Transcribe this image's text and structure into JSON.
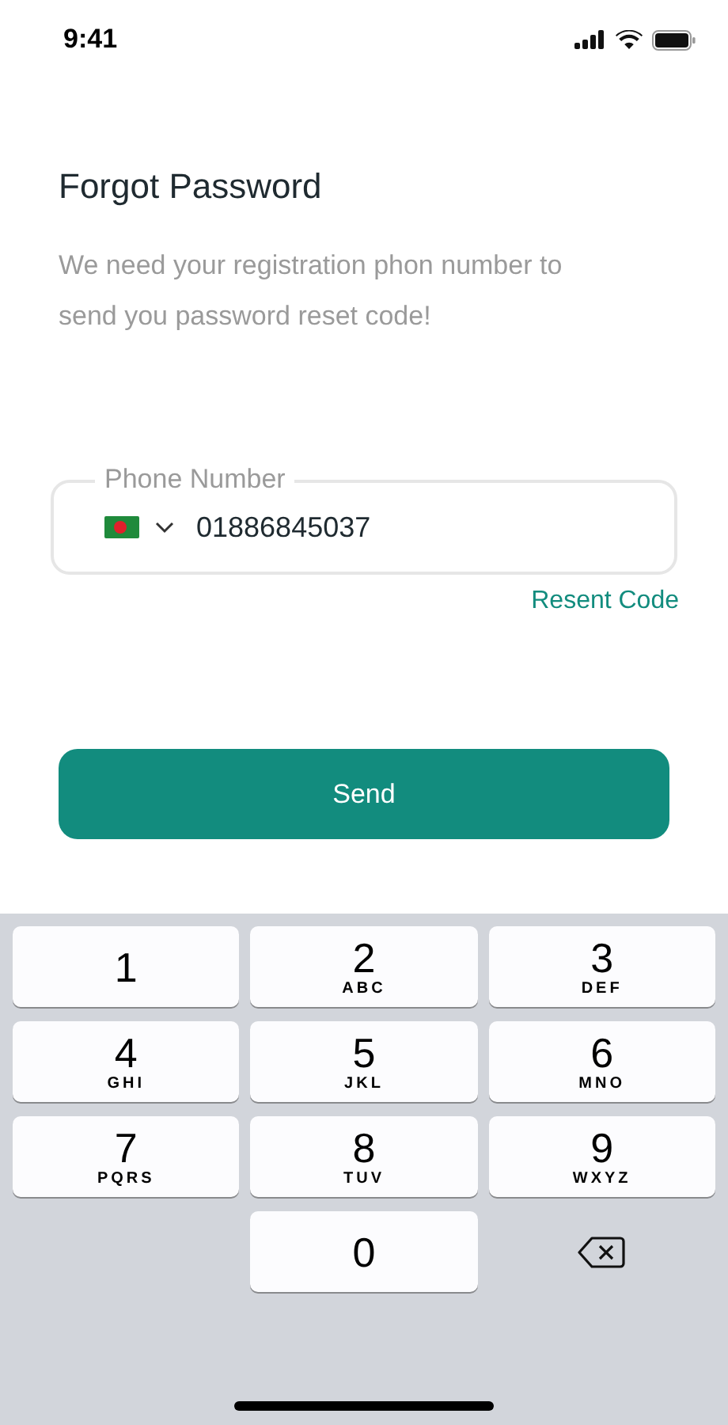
{
  "status_bar": {
    "time": "9:41"
  },
  "title": "Forgot Password",
  "description": "We need your registration phon number to send you password reset code!",
  "phone_field": {
    "label": "Phone Number",
    "value": "01886845037"
  },
  "resend_link": "Resent Code",
  "send_button": "Send",
  "keypad": [
    {
      "kind": "digit",
      "digit": "1"
    },
    {
      "kind": "digit",
      "digit": "2",
      "letters": "ABC"
    },
    {
      "kind": "digit",
      "digit": "3",
      "letters": "DEF"
    },
    {
      "kind": "digit",
      "digit": "4",
      "letters": "GHI"
    },
    {
      "kind": "digit",
      "digit": "5",
      "letters": "JKL"
    },
    {
      "kind": "digit",
      "digit": "6",
      "letters": "MNO"
    },
    {
      "kind": "digit",
      "digit": "7",
      "letters": "PQRS"
    },
    {
      "kind": "digit",
      "digit": "8",
      "letters": "TUV"
    },
    {
      "kind": "digit",
      "digit": "9",
      "letters": "WXYZ"
    },
    {
      "kind": "blank"
    },
    {
      "kind": "digit",
      "digit": "0"
    },
    {
      "kind": "delete"
    }
  ]
}
